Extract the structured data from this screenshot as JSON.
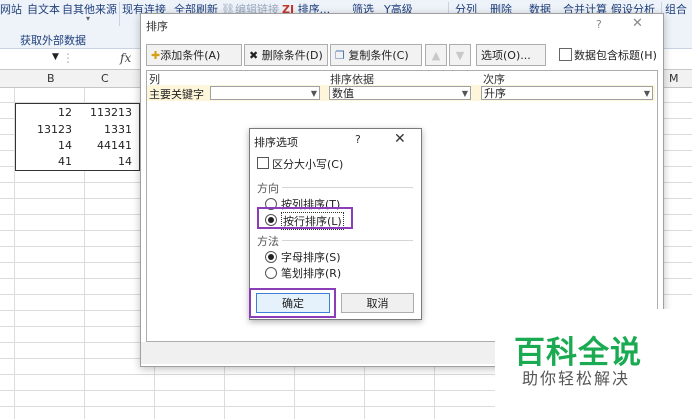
{
  "ribbon": {
    "items": [
      "网站",
      "自文本",
      "自其他来源",
      "现有连接",
      "全部刷新",
      "编辑链接",
      "排序...",
      "筛选",
      "高级",
      "分列",
      "删除",
      "数据",
      "合并计算",
      "假设分析",
      "组合"
    ],
    "sort_icon": "ZJ",
    "advanced_icon": "Y",
    "group_label": "获取外部数据"
  },
  "formula_bar": {
    "fx": "fx"
  },
  "columns": [
    "B",
    "C",
    "M"
  ],
  "cells": [
    [
      "12",
      "113213"
    ],
    [
      "13123",
      "1331"
    ],
    [
      "14",
      "44141"
    ],
    [
      "41",
      "14"
    ]
  ],
  "sort_dialog": {
    "title": "排序",
    "help": "?",
    "close": "✕",
    "toolbar": {
      "add": "添加条件(A)",
      "delete": "删除条件(D)",
      "copy": "复制条件(C)",
      "options": "选项(O)...",
      "header_check": "数据包含标题(H)"
    },
    "headers": {
      "column": "列",
      "sort_on": "排序依据",
      "order": "次序"
    },
    "row": {
      "label": "主要关键字",
      "key": "",
      "sort_on": "数值",
      "order": "升序"
    }
  },
  "options_dialog": {
    "title": "排序选项",
    "help": "?",
    "close": "✕",
    "case_sensitive": "区分大小写(C)",
    "direction_label": "方向",
    "by_column": "按列排序(T)",
    "by_row": "按行排序(L)",
    "method_label": "方法",
    "by_letter": "字母排序(S)",
    "by_stroke": "笔划排序(R)",
    "ok": "确定",
    "cancel": "取消",
    "selected_direction": "by_row",
    "selected_method": "by_letter"
  },
  "watermark": {
    "title": "百科全说",
    "subtitle": "助你轻松解决"
  },
  "colors": {
    "highlight": "#8a3fb8",
    "watermark_green": "#1aaa52",
    "ok_border": "#3c7fd4"
  }
}
